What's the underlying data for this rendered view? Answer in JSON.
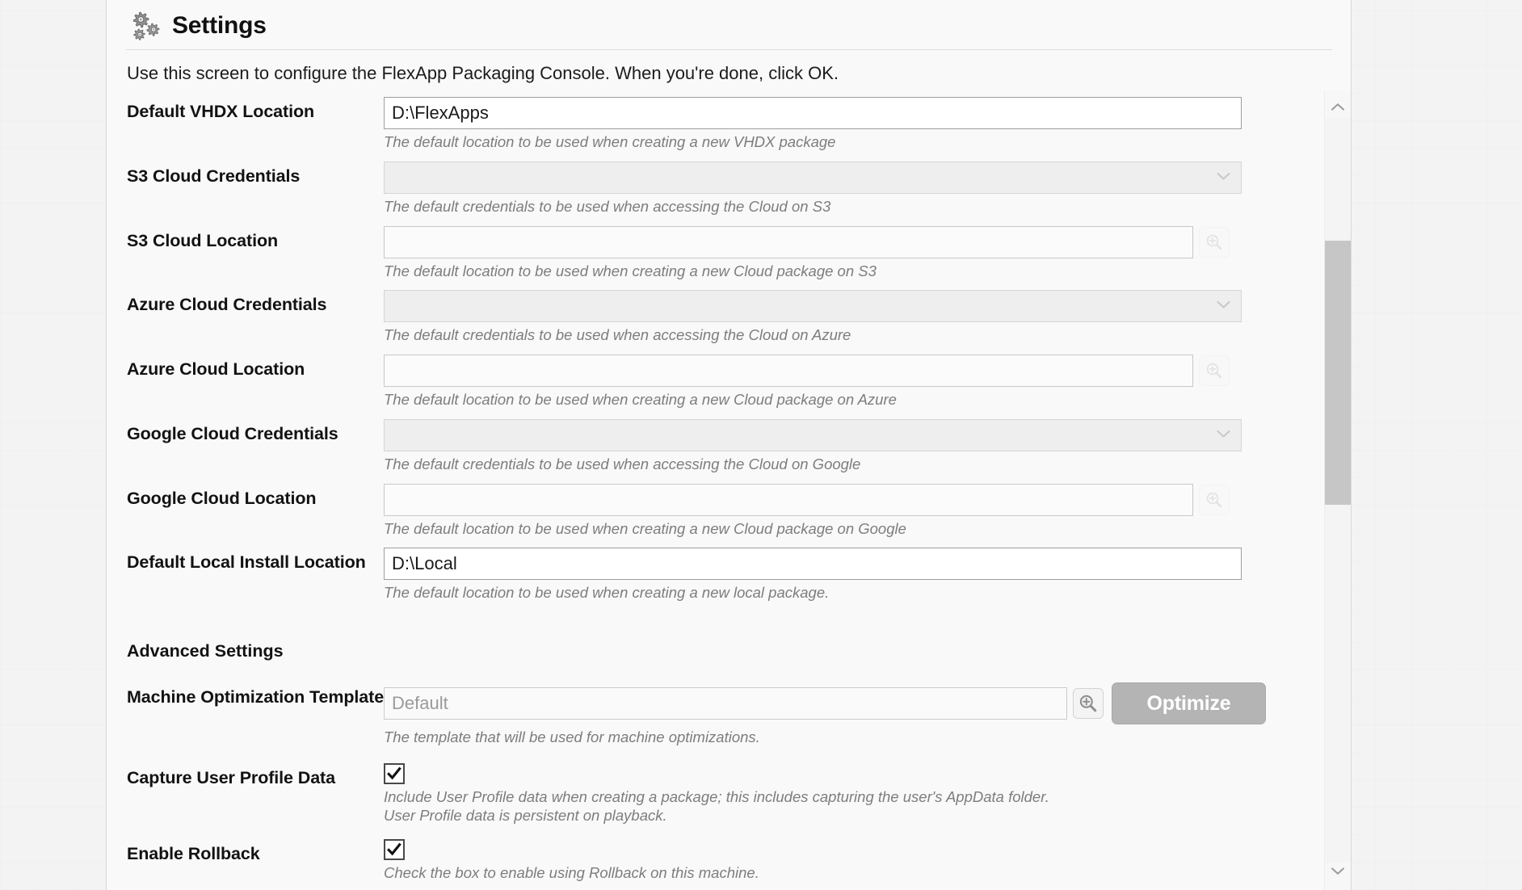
{
  "header": {
    "icon": "gears-icon",
    "title": "Settings"
  },
  "intro": "Use this screen to configure the FlexApp Packaging Console. When you're done, click OK.",
  "advanced_heading": "Advanced Settings",
  "fields": [
    {
      "label": "Default VHDX Location",
      "control": "text",
      "value": "D:\\FlexApps",
      "help": "The default location to be used when creating a new VHDX package"
    },
    {
      "label": "S3 Cloud Credentials",
      "control": "select",
      "value": "",
      "help": "The default credentials to be used when accessing the Cloud on S3"
    },
    {
      "label": "S3 Cloud Location",
      "control": "text-browse",
      "value": "",
      "help": "The default location to be used when creating a new Cloud package on S3",
      "browse_icon": "search-icon"
    },
    {
      "label": "Azure Cloud Credentials",
      "control": "select",
      "value": "",
      "help": "The default credentials to be used when accessing the Cloud on Azure"
    },
    {
      "label": "Azure Cloud Location",
      "control": "text-browse",
      "value": "",
      "help": "The default location to be used when creating a new Cloud package on Azure",
      "browse_icon": "search-icon"
    },
    {
      "label": "Google Cloud Credentials",
      "control": "select",
      "value": "",
      "help": "The default credentials to be used when accessing the Cloud on Google"
    },
    {
      "label": "Google Cloud Location",
      "control": "text-browse",
      "value": "",
      "help": "The default location to be used when creating a new Cloud package on Google",
      "browse_icon": "search-icon"
    },
    {
      "label": "Default Local Install Location",
      "control": "text",
      "value": "D:\\Local",
      "help": "The default location to be used when creating a new local package."
    }
  ],
  "advanced_fields": [
    {
      "label": "Machine Optimization Template",
      "control": "text-browse-button",
      "value": "",
      "placeholder": "Default",
      "help": "The template that will be used for machine optimizations.",
      "browse_icon": "search-icon",
      "button_label": "Optimize"
    },
    {
      "label": "Capture User Profile Data",
      "control": "checkbox",
      "checked": true,
      "help_line1": "Include User Profile data when creating a package; this includes capturing the user's AppData folder.",
      "help_line2": "User Profile data is persistent on playback."
    },
    {
      "label": "Enable Rollback",
      "control": "checkbox",
      "checked": true,
      "help": "Check the box to enable using Rollback on this machine."
    }
  ],
  "scrollbar": {
    "up_icon": "chevron-up-icon",
    "down_icon": "chevron-down-icon"
  },
  "colors": {
    "panel_bg": "#f9f9f9",
    "label_text": "#121212",
    "help_text": "#7d7d7d",
    "input_border": "#9c9ea2",
    "disabled_fill": "#eeeeee",
    "button_fill": "#b4b4b4",
    "scroll_thumb": "#c6c6c6"
  }
}
